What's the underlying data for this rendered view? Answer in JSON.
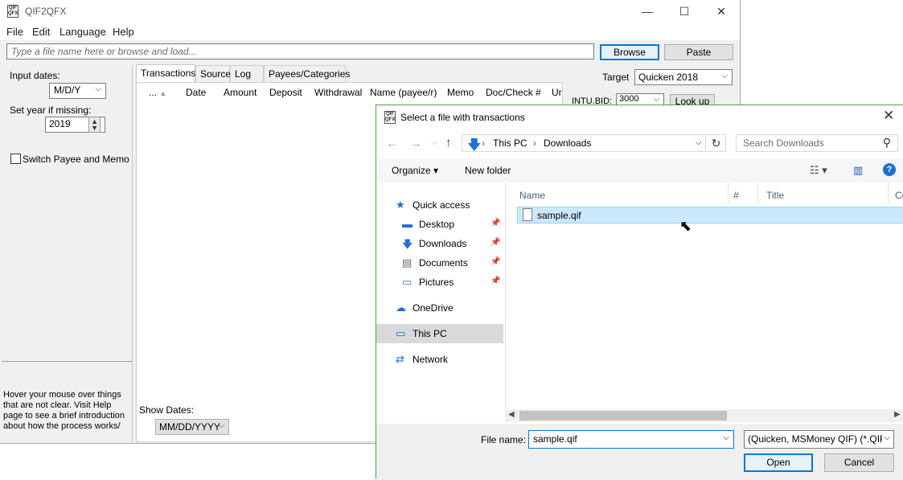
{
  "app": {
    "title": "QIF2QFX",
    "icon_text": "QIF QFX",
    "window_controls": {
      "minimize": "—",
      "maximize": "☐",
      "close": "✕"
    }
  },
  "menu": [
    "File",
    "Edit",
    "Language",
    "Help"
  ],
  "toolbar": {
    "file_input_placeholder": "Type a file name here or browse and load...",
    "browse_label": "Browse",
    "paste_label": "Paste"
  },
  "left_panel": {
    "input_dates_label": "Input dates:",
    "date_format": "M/D/Y",
    "set_year_label": "Set year if missing:",
    "year_value": "2019",
    "switch_label": "Switch Payee and Memo",
    "help_text": "Hover your mouse over things that are not clear. Visit Help page to see a brief introduction about how the process works/"
  },
  "tabs": [
    "Transactions",
    "Source",
    "Log",
    "Payees/Categories"
  ],
  "grid_columns": [
    "...",
    "Date",
    "Amount",
    "Deposit",
    "Withdrawal",
    "Name (payee/r)",
    "Memo",
    "Doc/Check #",
    "Ur"
  ],
  "show_dates": {
    "label": "Show Dates:",
    "value": "MM/DD/YYYY"
  },
  "right_panel": {
    "target_label": "Target",
    "target_value": "Quicken 2018",
    "intu_label": "INTU.BID:",
    "intu_value": "3000",
    "lookup_label": "Look up"
  },
  "dialog": {
    "title": "Select a file with transactions",
    "close_glyph": "✕",
    "path": [
      "This PC",
      "Downloads"
    ],
    "search_placeholder": "Search Downloads",
    "organize_label": "Organize ▾",
    "new_folder_label": "New folder",
    "nav_items": [
      {
        "label": "Quick access",
        "icon": "star-icon",
        "pinned": false
      },
      {
        "label": "Desktop",
        "icon": "desktop-icon",
        "pinned": true
      },
      {
        "label": "Downloads",
        "icon": "download-icon",
        "pinned": true
      },
      {
        "label": "Documents",
        "icon": "documents-icon",
        "pinned": true
      },
      {
        "label": "Pictures",
        "icon": "pictures-icon",
        "pinned": true
      },
      {
        "label": "OneDrive",
        "icon": "cloud-icon",
        "pinned": false
      },
      {
        "label": "This PC",
        "icon": "computer-icon",
        "pinned": false,
        "selected": true
      },
      {
        "label": "Network",
        "icon": "network-icon",
        "pinned": false
      }
    ],
    "file_columns": [
      "Name",
      "#",
      "Title",
      "Co"
    ],
    "files": [
      {
        "name": "sample.qif",
        "selected": true
      }
    ],
    "file_name_label": "File name:",
    "file_name_value": "sample.qif",
    "filter_value": "(Quicken, MSMoney QIF) (*.QIF",
    "open_label": "Open",
    "cancel_label": "Cancel"
  },
  "colors": {
    "accent_blue": "#0078d7",
    "selection": "#cce8ff",
    "dialog_border": "#4ba34b"
  }
}
